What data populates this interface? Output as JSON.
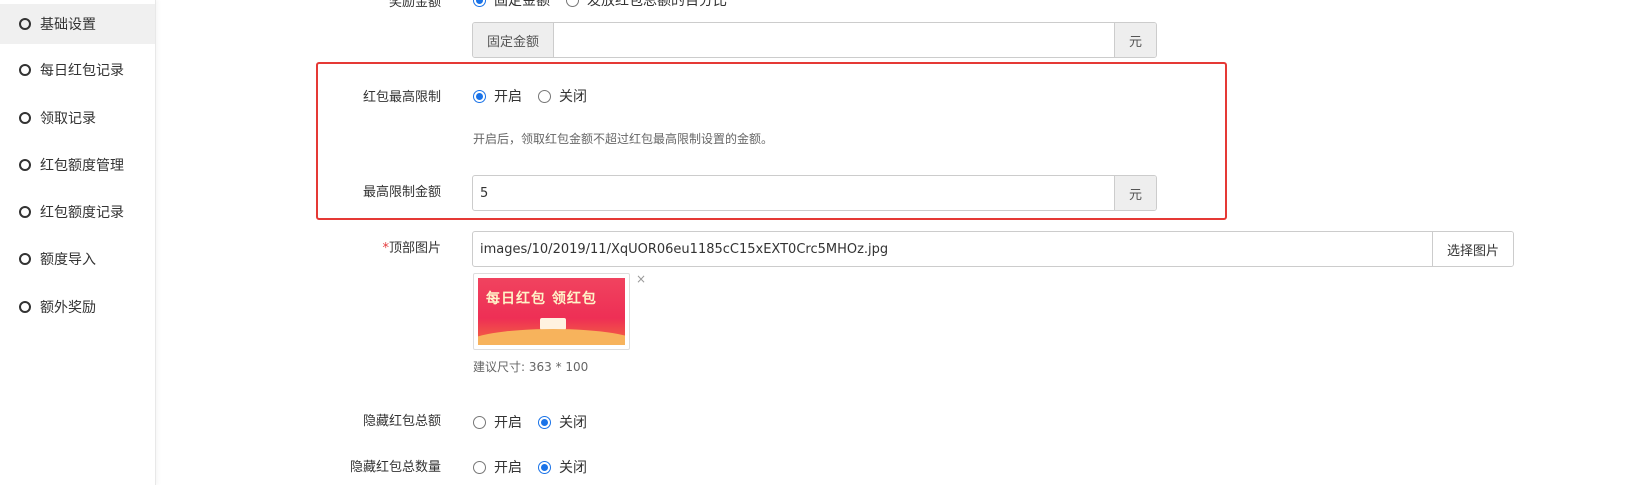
{
  "sidebar": {
    "items": [
      {
        "label": "基础设置",
        "active": true
      },
      {
        "label": "每日红包记录"
      },
      {
        "label": "领取记录"
      },
      {
        "label": "红包额度管理"
      },
      {
        "label": "红包额度记录"
      },
      {
        "label": "额度导入"
      },
      {
        "label": "额外奖励"
      }
    ]
  },
  "form": {
    "reward_amount": {
      "label": "奖励金额",
      "options": [
        "固定金额",
        "发放红包总额的百分比"
      ],
      "selected": "固定金额"
    },
    "fixed_amount": {
      "prefix": "固定金额",
      "value": "",
      "suffix": "元"
    },
    "max_limit": {
      "label": "红包最高限制",
      "options": [
        "开启",
        "关闭"
      ],
      "selected": "开启",
      "hint": "开启后，领取红包金额不超过红包最高限制设置的金额。"
    },
    "max_amount": {
      "label": "最高限制金额",
      "value": "5",
      "suffix": "元"
    },
    "top_image": {
      "required_mark": "*",
      "label": "顶部图片",
      "value": "images/10/2019/11/XqUOR06eu1185cC15xEXT0Crc5MHOz.jpg",
      "button": "选择图片",
      "close": "×",
      "banner_text": "每日红包 领红包",
      "hint": "建议尺寸: 363 * 100"
    },
    "hide_total": {
      "label": "隐藏红包总额",
      "options": [
        "开启",
        "关闭"
      ],
      "selected": "关闭"
    },
    "hide_count": {
      "label": "隐藏红包总数量",
      "options": [
        "开启",
        "关闭"
      ],
      "selected": "关闭"
    }
  },
  "colors": {
    "accent": "#1a73e8",
    "highlight_border": "#e53935",
    "required": "#e4393c"
  }
}
